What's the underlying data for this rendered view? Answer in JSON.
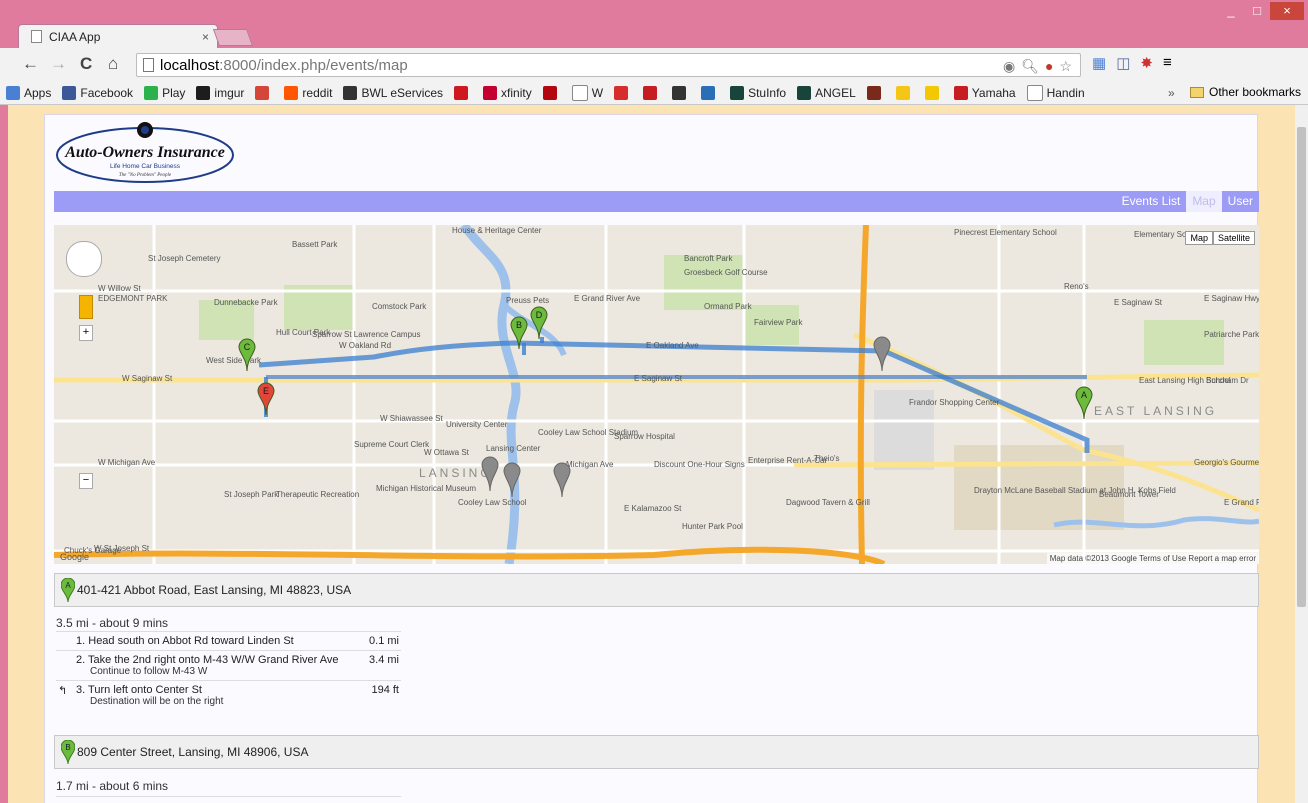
{
  "window": {
    "minimize": "_",
    "maximize": "□",
    "close": "×"
  },
  "tab": {
    "title": "CIAA App",
    "close": "×"
  },
  "toolbar": {
    "back": "←",
    "forward": "→",
    "reload": "C",
    "home": "⌂",
    "url_host": "localhost",
    "url_path": ":8000/index.php/events/map",
    "star": "☆",
    "menu": "≡"
  },
  "bookmarks": {
    "items": [
      {
        "label": "Apps",
        "icon": "apps-grid-icon",
        "color": "#4a7fd6"
      },
      {
        "label": "Facebook",
        "icon": "facebook-icon",
        "color": "#3b5998"
      },
      {
        "label": "Play",
        "icon": "play-icon",
        "color": "#2bb24c"
      },
      {
        "label": "imgur",
        "icon": "imgur-icon",
        "color": "#1d1d1d"
      },
      {
        "label": "",
        "icon": "gmail-icon",
        "color": "#d44638"
      },
      {
        "label": "reddit",
        "icon": "reddit-icon",
        "color": "#ff5700"
      },
      {
        "label": "BWL eServices",
        "icon": "bwl-icon",
        "color": "#333333"
      },
      {
        "label": "",
        "icon": "youtube-icon",
        "color": "#cc181e"
      },
      {
        "label": "xfinity",
        "icon": "xfinity-icon",
        "color": "#c3002f"
      },
      {
        "label": "",
        "icon": "netflix-icon",
        "color": "#b20710"
      },
      {
        "label": "W",
        "icon": "wikipedia-icon",
        "color": "#ffffff"
      },
      {
        "label": "",
        "icon": "bank-icon",
        "color": "#d62c2c"
      },
      {
        "label": "",
        "icon": "f-icon",
        "color": "#c61d23"
      },
      {
        "label": "",
        "icon": "bus-icon",
        "color": "#333333"
      },
      {
        "label": "",
        "icon": "disc-icon",
        "color": "#2a6fb5"
      },
      {
        "label": "StuInfo",
        "icon": "s-green-icon",
        "color": "#18453b"
      },
      {
        "label": "ANGEL",
        "icon": "s-green-icon",
        "color": "#18453b"
      },
      {
        "label": "",
        "icon": "dota-icon",
        "color": "#7a2a1a"
      },
      {
        "label": "",
        "icon": "imdb-icon",
        "color": "#f5c518"
      },
      {
        "label": "",
        "icon": "ring-icon",
        "color": "#f3c800"
      },
      {
        "label": "Yamaha",
        "icon": "yamaha-icon",
        "color": "#c71c22"
      },
      {
        "label": "Handin",
        "icon": "page-icon",
        "color": "#ffffff"
      }
    ],
    "more": "»",
    "other": "Other bookmarks"
  },
  "header": {
    "logo_title": "Auto-Owners Insurance",
    "logo_subtitle": "Life Home Car Business",
    "logo_tagline": "The \"No Problem\" People"
  },
  "nav": {
    "items": [
      {
        "label": "Events List",
        "active": false
      },
      {
        "label": "Map",
        "active": true
      },
      {
        "label": "User",
        "active": false
      }
    ]
  },
  "map": {
    "type_buttons": [
      "Map",
      "Satellite"
    ],
    "footer": "Map data ©2013 Google  Terms of Use  Report a map error",
    "google": "Google",
    "labels": [
      "Bassett Park",
      "St Joseph Cemetery",
      "W Willow St",
      "EDGEMONT PARK",
      "Dunnebacke Park",
      "Comstock Park",
      "Hull Court Park",
      "Sparrow St Lawrence Campus",
      "West Side Park",
      "W Oakland Rd",
      "W Saginaw St",
      "House & Heritage Center",
      "Preuss Pets",
      "Bancroft Park",
      "Groesbeck Golf Course",
      "E Grand River Ave",
      "Ormand Park",
      "Fairview Park",
      "E Oakland Ave",
      "E Saginaw St",
      "Pinecrest Elementary School",
      "Elementary School",
      "Reno's",
      "E Saginaw St",
      "Patriarche Park",
      "East Lansing High School",
      "Burcham Dr",
      "W Shiawassee St",
      "University Center",
      "Supreme Court Clerk",
      "Cooley Law School Stadium",
      "Sparrow Hospital",
      "W Ottawa St",
      "Lansing Center",
      "LANSING",
      "W Michigan Ave",
      "Michigan Ave",
      "Discount One-Hour Signs",
      "Enterprise Rent-A-Car",
      "Theio's",
      "Frandor Shopping Center",
      "EAST LANSING",
      "Georgio's Gourmet Pizzeria",
      "St Joseph Park",
      "Therapeutic Recreation",
      "Michigan Historical Museum",
      "Cooley Law School",
      "E Kalamazoo St",
      "Hunter Park Pool",
      "Dagwood Tavern & Grill",
      "Drayton McLane Baseball Stadium at John H. Kobs Field",
      "Beaumont Tower",
      "E Grand River",
      "Chuck's Garage",
      "W St Joseph St",
      "E Saginaw Hwy"
    ],
    "markers": [
      "A",
      "B",
      "C",
      "D",
      "E"
    ]
  },
  "directions": {
    "legs": [
      {
        "marker": "A",
        "address": "401-421 Abbot Road, East Lansing, MI 48823, USA"
      },
      {
        "marker": "B",
        "address": "809 Center Street, Lansing, MI 48906, USA"
      }
    ],
    "summary1": "3.5 mi - about 9 mins",
    "summary2": "1.7 mi - about 6 mins",
    "steps": [
      {
        "num": "1.",
        "text": "Head south on Abbot Rd toward Linden St",
        "sub": "",
        "dist": "0.1 mi"
      },
      {
        "num": "2.",
        "text": "Take the 2nd right onto M-43 W/W Grand River Ave",
        "sub": "Continue to follow M-43 W",
        "dist": "3.4 mi"
      },
      {
        "num": "3.",
        "text": "Turn left onto Center St",
        "sub": "Destination will be on the right",
        "dist": "194 ft",
        "arrow": "↰"
      }
    ]
  }
}
